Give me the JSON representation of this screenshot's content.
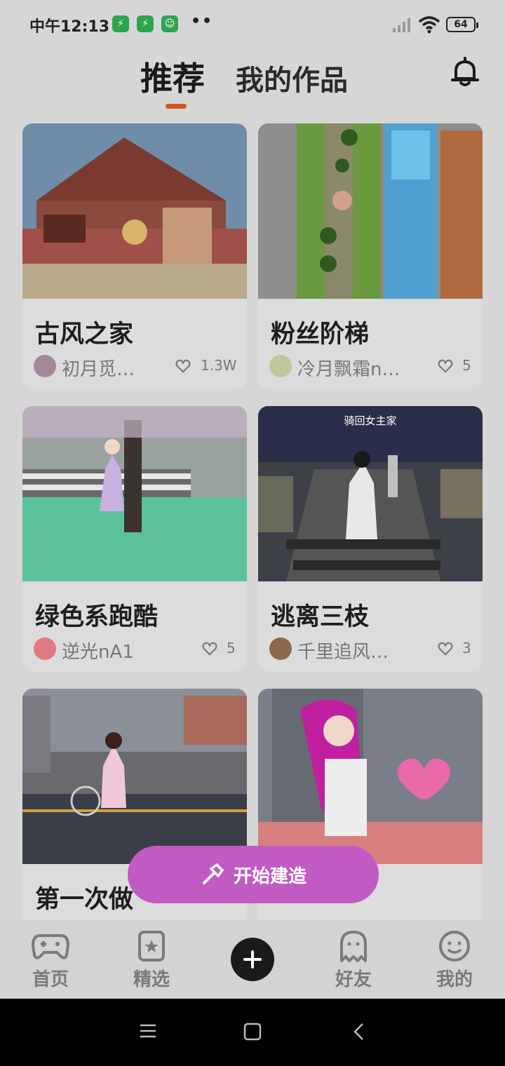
{
  "status_bar": {
    "time": "中午12:13",
    "battery": "64",
    "dots": "••"
  },
  "header": {
    "tabs": [
      {
        "label": "推荐",
        "active": true
      },
      {
        "label": "我的作品",
        "active": false
      }
    ],
    "accent_color": "#d9541e"
  },
  "cards": [
    {
      "title": "古风之家",
      "author": "初月觅…",
      "likes": "1.3W",
      "caption": ""
    },
    {
      "title": "粉丝阶梯",
      "author": "冷月飘霜n…",
      "likes": "5",
      "caption": ""
    },
    {
      "title": "绿色系跑酷",
      "author": "逆光nA1",
      "likes": "5",
      "caption": ""
    },
    {
      "title": "逃离三枝",
      "author": "千里追风…",
      "likes": "3",
      "caption": "骑回女主家"
    },
    {
      "title": "第一次做",
      "author": "",
      "likes": "",
      "caption": ""
    },
    {
      "title": "",
      "author": "",
      "likes": "",
      "caption": ""
    }
  ],
  "build_button": {
    "label": "开始建造",
    "color": "#c15bc4"
  },
  "bottom_nav": {
    "items": [
      {
        "label": "首页",
        "icon": "gamepad-icon"
      },
      {
        "label": "精选",
        "icon": "star-bookmark-icon"
      },
      {
        "label": "",
        "icon": "plus-icon"
      },
      {
        "label": "好友",
        "icon": "ghost-icon"
      },
      {
        "label": "我的",
        "icon": "smiley-icon"
      }
    ]
  }
}
